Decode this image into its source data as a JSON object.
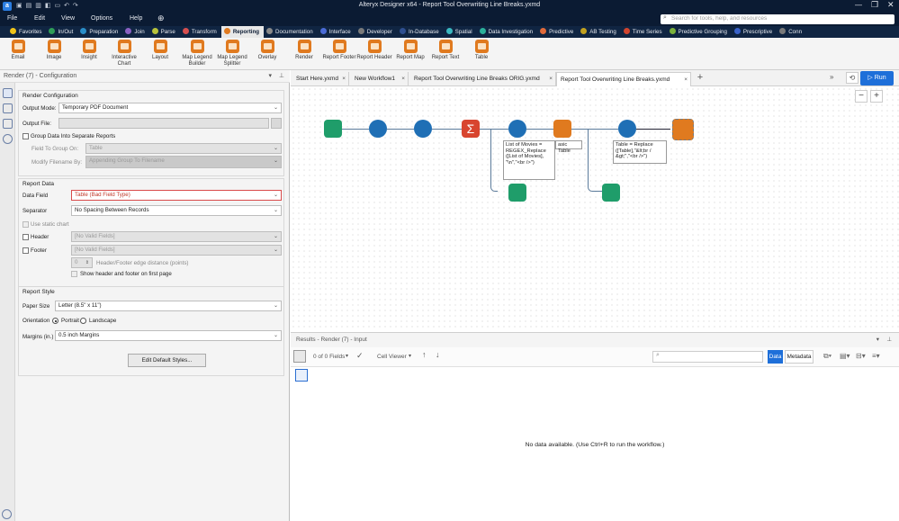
{
  "app": {
    "title": "Alteryx Designer x64 - Report Tool Overwriting Line Breaks.yxmd",
    "search_placeholder": "Search for tools, help, and resources",
    "menus": [
      "File",
      "Edit",
      "View",
      "Options",
      "Help"
    ]
  },
  "categories": [
    {
      "label": "Favorites",
      "color": "#f0c419"
    },
    {
      "label": "In/Out",
      "color": "#2f9e57"
    },
    {
      "label": "Preparation",
      "color": "#2a8ec8"
    },
    {
      "label": "Join",
      "color": "#8b61c2"
    },
    {
      "label": "Parse",
      "color": "#b7c23a"
    },
    {
      "label": "Transform",
      "color": "#d64f4f"
    },
    {
      "label": "Reporting",
      "color": "#e07a1f",
      "active": true
    },
    {
      "label": "Documentation",
      "color": "#8a8a8a"
    },
    {
      "label": "Interface",
      "color": "#4a6bd6"
    },
    {
      "label": "Developer",
      "color": "#7a7a7a"
    },
    {
      "label": "In-Database",
      "color": "#2f4f8f"
    },
    {
      "label": "Spatial",
      "color": "#3bb8c0"
    },
    {
      "label": "Data Investigation",
      "color": "#2bb19a"
    },
    {
      "label": "Predictive",
      "color": "#e06a3a"
    },
    {
      "label": "AB Testing",
      "color": "#c2a11f"
    },
    {
      "label": "Time Series",
      "color": "#d0442e"
    },
    {
      "label": "Predictive Grouping",
      "color": "#7ab13a"
    },
    {
      "label": "Prescriptive",
      "color": "#3a62c9"
    },
    {
      "label": "Conn",
      "color": "#7a7a7a"
    }
  ],
  "tools": [
    {
      "label": "Email"
    },
    {
      "label": "Image"
    },
    {
      "label": "Insight"
    },
    {
      "label": "Interactive Chart"
    },
    {
      "label": "Layout"
    },
    {
      "label": "Map Legend Builder"
    },
    {
      "label": "Map Legend Splitter"
    },
    {
      "label": "Overlay"
    },
    {
      "label": "Render"
    },
    {
      "label": "Report Footer"
    },
    {
      "label": "Report Header"
    },
    {
      "label": "Report Map"
    },
    {
      "label": "Report Text"
    },
    {
      "label": "Table"
    }
  ],
  "config": {
    "header": "Render (7) - Configuration",
    "render_config_title": "Render Configuration",
    "output_mode_label": "Output Mode:",
    "output_mode_value": "Temporary PDF Document",
    "output_file_label": "Output File:",
    "group_label": "Group Data Into Separate Reports",
    "field_to_group_label": "Field To Group On:",
    "field_to_group_value": "Table",
    "modify_filename_label": "Modify Filename By:",
    "modify_filename_value": "Appending Group To Filename",
    "report_data_title": "Report Data",
    "data_field_label": "Data Field",
    "data_field_value": "Table (Bad Field Type)",
    "separator_label": "Separator",
    "separator_value": "No Spacing Between Records",
    "static_chart_label": "Use static chart",
    "header_label": "Header",
    "header_value": "[No Valid Fields]",
    "footer_label": "Footer",
    "footer_value": "[No Valid Fields]",
    "edge_value": "0",
    "edge_label": "Header/Footer edge distance (points)",
    "show_hf_label": "Show header and footer on first page",
    "report_style_title": "Report Style",
    "paper_size_label": "Paper Size",
    "paper_size_value": "Letter (8.5\" x 11\")",
    "orientation_label": "Orientation",
    "portrait_label": "Portrait",
    "landscape_label": "Landscape",
    "margins_label": "Margins (in.)",
    "margins_value": "0.5 inch Margins",
    "edit_styles_label": "Edit Default Styles..."
  },
  "tabs": [
    {
      "label": "Start Here.yxmd"
    },
    {
      "label": "New Workflow1"
    },
    {
      "label": "Report Tool Overwriting Line Breaks ORIG.yxmd"
    },
    {
      "label": "Report Tool Overwriting Line Breaks.yxmd",
      "active": true
    }
  ],
  "run_label": "Run",
  "canvas": {
    "annotation1": "List of Movies = REGEX_Replace ([List of Movies], \"\\n\",\"<br />\")",
    "annotation1_tail": "asic Table",
    "annotation2": "Table = Replace ([Table],\"&lt;br / &gt;\",\"<br />\")"
  },
  "results": {
    "header": "Results - Render (7) - Input",
    "fields": "0 of 0 Fields",
    "cell_viewer": "Cell Viewer",
    "data_tab": "Data",
    "metadata_tab": "Metadata",
    "empty_message": "No data available. (Use Ctrl+R to run the workflow.)"
  }
}
